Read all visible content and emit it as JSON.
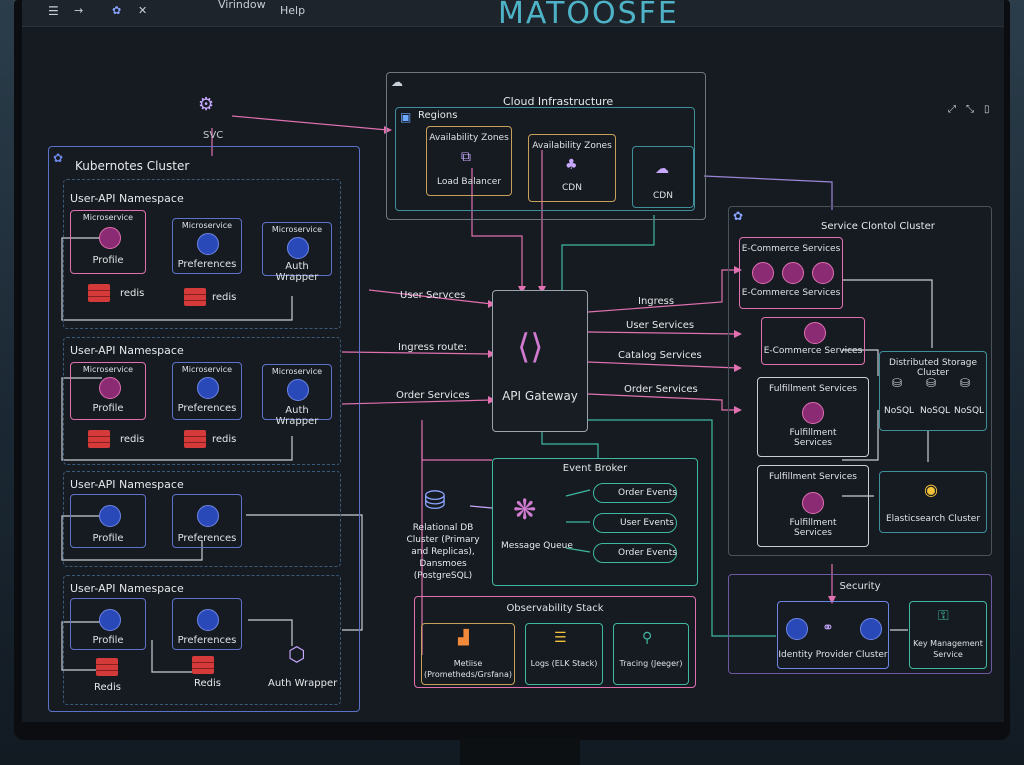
{
  "window": {
    "menu": [
      "Virindow",
      "Help"
    ],
    "app_title": "MATOOSFE"
  },
  "svc": {
    "label": "SVC"
  },
  "cloud": {
    "title": "Cloud Infrastructure",
    "regions": "Regions",
    "az1": "Availability Zones",
    "az1_item": "Load Balancer",
    "az2": "Availability Zones",
    "az2_item": "CDN",
    "cdn": "CDN"
  },
  "k8s": {
    "title": "Kubernotes Cluster",
    "namespaces": [
      {
        "title": "User-API Namespace",
        "svc1_tag": "Microservice",
        "svc1": "Profile",
        "svc2_tag": "Microservice",
        "svc2": "Preferences",
        "svc3_tag": "Microservice",
        "svc3": "Auth Wrapper",
        "redis1": "redis",
        "redis2": "redis"
      },
      {
        "title": "User-API Namespace",
        "svc1_tag": "Microservice",
        "svc1": "Profile",
        "svc2_tag": "Microservice",
        "svc2": "Preferences",
        "svc3_tag": "Microservice",
        "svc3": "Auth Wrapper",
        "redis1": "redis",
        "redis2": "redis"
      },
      {
        "title": "User-API Namespace",
        "svc1": "Profile",
        "svc2": "Preferences"
      },
      {
        "title": "User-API Namespace",
        "svc1": "Profile",
        "svc2": "Preferences",
        "svc3": "Auth Wrapper",
        "redis1": "Redis",
        "redis2": "Redis"
      }
    ]
  },
  "links": {
    "user_services_left": "User Servces",
    "ingress_route": "Ingress route:",
    "order_services_left": "Order Services",
    "ingress": "Ingress",
    "user_services_right": "User Services",
    "catalog_services": "Catalog Services",
    "order_services_right": "Order Services"
  },
  "gateway": {
    "label": "API Gateway"
  },
  "service_cluster": {
    "title": "Service Clontol Cluster",
    "ecommerce_group": "E-Commerce Services",
    "ecommerce_group_sub": "E-Commerce Services",
    "ecommerce_single": "E-Commerce Services",
    "fulfillment1_title": "Fulfillment Services",
    "fulfillment1_item": "Fulfillment Services",
    "fulfillment2_title": "Fulfillment Services",
    "fulfillment2_item": "Fulfillment Services",
    "storage_title": "Distributed Storage Cluster",
    "storage": [
      "NoSQL",
      "NoSQL",
      "NoSQL"
    ],
    "elastic": "Elasticsearch Cluster"
  },
  "broker": {
    "title": "Event Broker",
    "queue": "Message Queue",
    "events": [
      "Order Events",
      "User Events",
      "Order Events"
    ]
  },
  "db": {
    "label": "Relational DB Cluster (Primary and Replicas), Dansmoes (PostgreSQL)"
  },
  "observability": {
    "title": "Observability Stack",
    "metrics": "Metiise (Prometheds/Grsfana)",
    "logs": "Logs (ELK Stack)",
    "tracing": "Tracing (Jeeger)"
  },
  "security": {
    "title": "Security",
    "idp": "Identity Provider Cluster",
    "kms": "Key Management Service"
  },
  "colors": {
    "accent": "#4fb3c8",
    "pink": "#e070b0",
    "teal": "#3fb8a0",
    "blue": "#6d86e6"
  }
}
